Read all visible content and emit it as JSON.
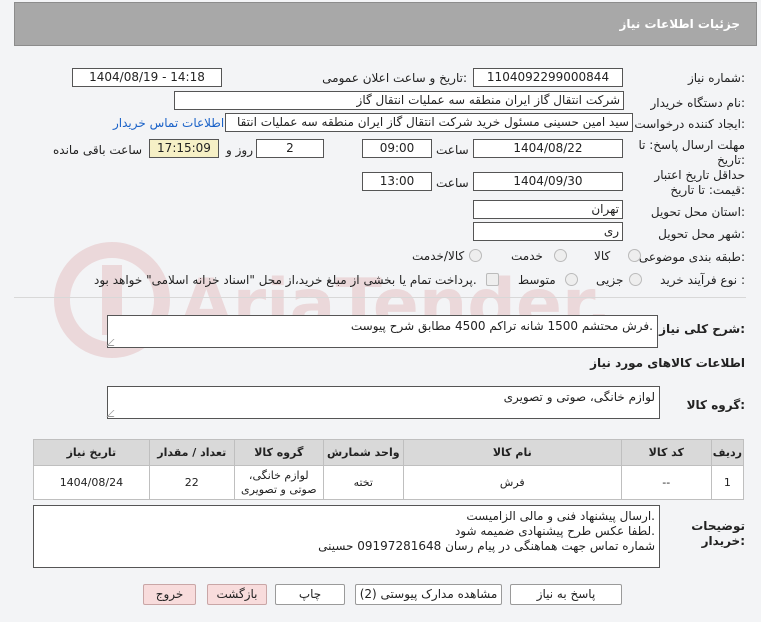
{
  "header": {
    "title": "جزئیات اطلاعات نیاز"
  },
  "form": {
    "need_number_label": "شماره نیاز:",
    "need_number": "1104092299000844",
    "announce_label": "تاریخ و ساعت اعلان عمومی:",
    "announce_value": "1404/08/19 - 14:18",
    "buyer_org_label": "نام دستگاه خریدار:",
    "buyer_org": "شرکت انتقال گاز ایران منطقه سه عملیات انتقال گاز",
    "requester_label": "ایجاد کننده درخواست:",
    "requester": "سید امین حسینی مسئول خرید شرکت انتقال گاز ایران منطقه سه عملیات انتقا",
    "contact_link": "اطلاعات تماس خریدار",
    "deadline_label_1": "مهلت ارسال پاسخ: تا",
    "deadline_label_2": "تاریخ:",
    "deadline_date": "1404/08/22",
    "hour_label": "ساعت",
    "deadline_time": "09:00",
    "days_value": "2",
    "days_label": "روز و",
    "remaining_time": "17:15:09",
    "remaining_label": "ساعت باقی مانده",
    "validity_label_1": "حداقل تاریخ اعتبار",
    "validity_label_2": "قیمت: تا تاریخ:",
    "validity_date": "1404/09/30",
    "validity_time": "13:00",
    "province_label": "استان محل تحویل:",
    "province": "تهران",
    "city_label": "شهر محل تحویل:",
    "city": "ری",
    "category_label": "طبقه بندی موضوعی:",
    "category_options": [
      "کالا",
      "خدمت",
      "کالا/خدمت"
    ],
    "process_label": "نوع فرآیند خرید :",
    "process_options": [
      "جزیی",
      "متوسط"
    ],
    "payment_note": "پرداخت تمام یا بخشی از مبلغ خرید،از محل \"اسناد خزانه اسلامی\" خواهد بود.",
    "desc_label": "شرح کلی نیاز:",
    "desc_value": "فرش محتشم 1500 شانه تراکم 4500 مطابق شرح پیوست.",
    "goods_info_title": "اطلاعات کالاهای مورد نیاز",
    "goods_group_label": "گروه کالا:",
    "goods_group_value": "لوازم خانگی، صوتی و تصویری"
  },
  "table": {
    "headers": [
      "ردیف",
      "کد کالا",
      "نام کالا",
      "واحد شمارش",
      "گروه کالا",
      "تعداد / مقدار",
      "تاریخ نیاز"
    ],
    "rows": [
      {
        "row": "1",
        "code": "--",
        "name": "فرش",
        "unit": "تخته",
        "group_1": "لوازم خانگی،",
        "group_2": "صوتی و تصویری",
        "qty": "22",
        "date": "1404/08/24"
      }
    ]
  },
  "notes": {
    "label_1": "توضیحات",
    "label_2": "خریدار:",
    "lines": [
      "ارسال پیشنهاد فنی و مالی الزامیست.",
      "لطفا عکس طرح پیشنهادی ضمیمه شود.",
      "شماره تماس جهت هماهنگی در پیام رسان 09197281648 حسینی"
    ]
  },
  "buttons": {
    "reply": "پاسخ به نیاز",
    "docs": "مشاهده مدارک پیوستی (2)",
    "print": "چاپ",
    "back": "بازگشت",
    "exit": "خروج"
  },
  "watermark": {
    "text": "AriaTender.net"
  },
  "colors": {
    "header_bg": "#a8a8a8",
    "link": "#1a62c8",
    "highlight": "#f6f0c6",
    "pink_button": "#f8dcdc"
  }
}
